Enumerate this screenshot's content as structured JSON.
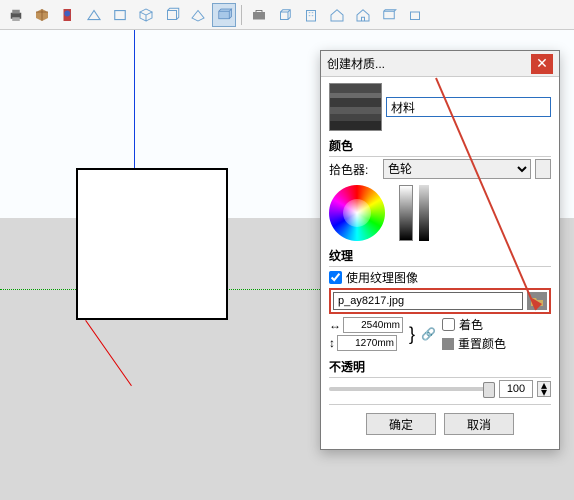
{
  "toolbar": {
    "icons": [
      "printer",
      "package",
      "info",
      "box1",
      "box2",
      "box3",
      "box4",
      "box5",
      "box6",
      "portfolio",
      "cube",
      "building",
      "house",
      "house2",
      "box7",
      "box8"
    ]
  },
  "dialog": {
    "title": "创建材质...",
    "name_value": "材料",
    "section_color": "颜色",
    "picker_label": "拾色器:",
    "picker_value": "色轮",
    "section_texture": "纹理",
    "use_texture_label": "使用纹理图像",
    "texture_file": "p_ay8217.jpg",
    "width_value": "2540mm",
    "height_value": "1270mm",
    "colorize_label": "着色",
    "reset_color_label": "重置颜色",
    "section_opacity": "不透明",
    "opacity_value": "100",
    "ok": "确定",
    "cancel": "取消"
  }
}
